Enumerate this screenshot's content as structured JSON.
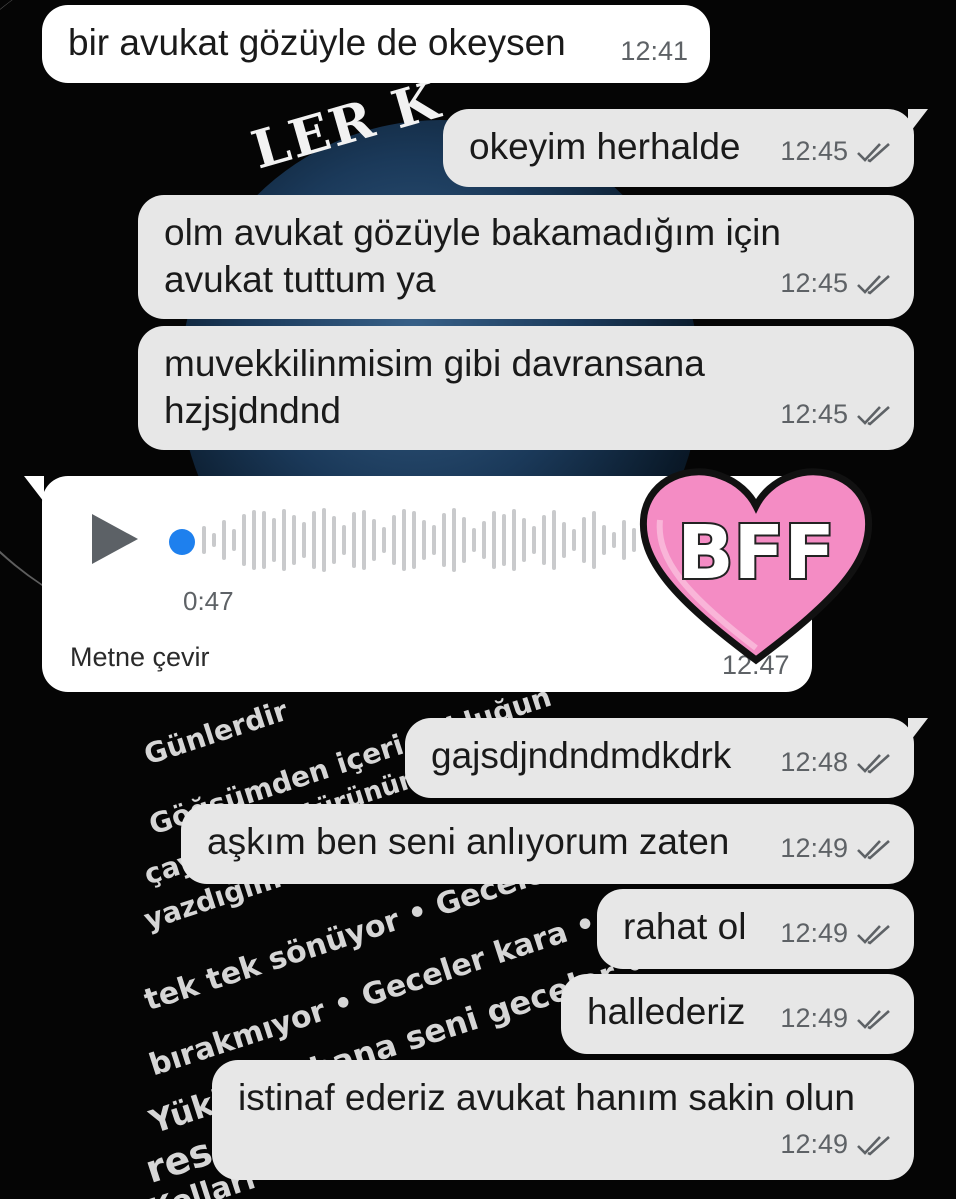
{
  "wallpaper": {
    "title_fragment": "LER K",
    "lines": [
      "Günlerdir",
      "Göğsümden içeri yokluğun",
      "türünüm",
      "çay",
      "yazdığım",
      "tek tek sönüyor • Geceler kara tren",
      "bırakmıyor • Geceler kara • Be",
      "Yüklüyor bana seni geceler • üzüme",
      "res",
      "Kolları"
    ]
  },
  "messages": [
    {
      "id": "m1",
      "direction": "incoming",
      "text": [
        "bir avukat gözüyle de okeysen"
      ],
      "time": "12:41",
      "read": false
    },
    {
      "id": "m2",
      "direction": "outgoing",
      "text": [
        "okeyim herhalde"
      ],
      "time": "12:45",
      "read": true
    },
    {
      "id": "m3",
      "direction": "outgoing",
      "text": [
        "olm avukat gözüyle bakamadığım için",
        "avukat tuttum ya"
      ],
      "time": "12:45",
      "read": true
    },
    {
      "id": "m4",
      "direction": "outgoing",
      "text": [
        "muvekkilinmisim gibi davransana",
        "hzjsjdndnd"
      ],
      "time": "12:45",
      "read": true
    },
    {
      "id": "m6",
      "direction": "outgoing",
      "text": [
        "gajsdjndndmdkdrk"
      ],
      "time": "12:48",
      "read": true
    },
    {
      "id": "m7",
      "direction": "outgoing",
      "text": [
        "aşkım ben seni anlıyorum zaten"
      ],
      "time": "12:49",
      "read": true
    },
    {
      "id": "m8",
      "direction": "outgoing",
      "text": [
        "rahat ol"
      ],
      "time": "12:49",
      "read": true
    },
    {
      "id": "m9",
      "direction": "outgoing",
      "text": [
        "hallederiz"
      ],
      "time": "12:49",
      "read": true
    },
    {
      "id": "m10",
      "direction": "outgoing",
      "text": [
        "istinaf ederiz avukat hanım sakin olun"
      ],
      "time": "12:49",
      "read": true
    }
  ],
  "voice_message": {
    "duration": "0:47",
    "translate_label": "Metne çevir",
    "time": "12:47",
    "progress": 0,
    "play_icon": "play-icon"
  },
  "sticker": {
    "text": "BFF",
    "icon": "heart-icon",
    "color": "#f48cc4"
  },
  "colors": {
    "outgoing_bubble": "#e7e7e7",
    "incoming_bubble": "#ffffff",
    "accent": "#1e80ee",
    "tick": "#5e6266"
  }
}
